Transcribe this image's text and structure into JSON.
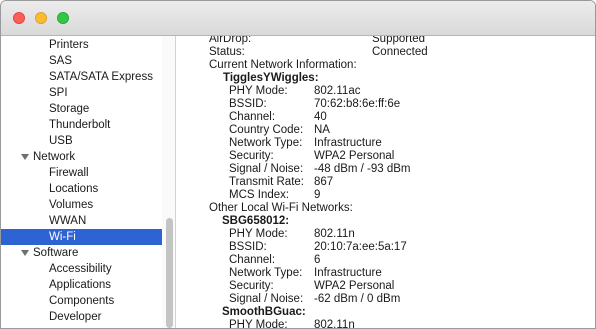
{
  "window": {
    "title": ""
  },
  "sidebar": {
    "items": [
      {
        "label": "Printers",
        "type": "child"
      },
      {
        "label": "SAS",
        "type": "child"
      },
      {
        "label": "SATA/SATA Express",
        "type": "child"
      },
      {
        "label": "SPI",
        "type": "child"
      },
      {
        "label": "Storage",
        "type": "child"
      },
      {
        "label": "Thunderbolt",
        "type": "child"
      },
      {
        "label": "USB",
        "type": "child"
      },
      {
        "label": "Network",
        "type": "category"
      },
      {
        "label": "Firewall",
        "type": "child"
      },
      {
        "label": "Locations",
        "type": "child"
      },
      {
        "label": "Volumes",
        "type": "child"
      },
      {
        "label": "WWAN",
        "type": "child"
      },
      {
        "label": "Wi-Fi",
        "type": "child",
        "selected": true
      },
      {
        "label": "Software",
        "type": "category"
      },
      {
        "label": "Accessibility",
        "type": "child"
      },
      {
        "label": "Applications",
        "type": "child"
      },
      {
        "label": "Components",
        "type": "child"
      },
      {
        "label": "Developer",
        "type": "child"
      }
    ]
  },
  "details": {
    "airdrop": {
      "label": "AirDrop:",
      "value": "Supported"
    },
    "status": {
      "label": "Status:",
      "value": "Connected"
    },
    "current_header": "Current Network Information:",
    "current_name": "TigglesYWiggles:",
    "current_fields": [
      {
        "label": "PHY Mode:",
        "value": "802.11ac"
      },
      {
        "label": "BSSID:",
        "value": "70:62:b8:6e:ff:6e"
      },
      {
        "label": "Channel:",
        "value": "40"
      },
      {
        "label": "Country Code:",
        "value": "NA"
      },
      {
        "label": "Network Type:",
        "value": "Infrastructure"
      },
      {
        "label": "Security:",
        "value": "WPA2 Personal"
      },
      {
        "label": "Signal / Noise:",
        "value": "-48 dBm / -93 dBm"
      },
      {
        "label": "Transmit Rate:",
        "value": "867"
      },
      {
        "label": "MCS Index:",
        "value": "9"
      }
    ],
    "other_header": "Other Local Wi-Fi Networks:",
    "other_networks": [
      {
        "name": "SBG658012:",
        "fields": [
          {
            "label": "PHY Mode:",
            "value": "802.11n"
          },
          {
            "label": "BSSID:",
            "value": "20:10:7a:ee:5a:17"
          },
          {
            "label": "Channel:",
            "value": "6"
          },
          {
            "label": "Network Type:",
            "value": "Infrastructure"
          },
          {
            "label": "Security:",
            "value": "WPA2 Personal"
          },
          {
            "label": "Signal / Noise:",
            "value": "-62 dBm / 0 dBm"
          }
        ]
      },
      {
        "name": "SmoothBGuac:",
        "fields": [
          {
            "label": "PHY Mode:",
            "value": "802.11n"
          }
        ]
      }
    ]
  }
}
